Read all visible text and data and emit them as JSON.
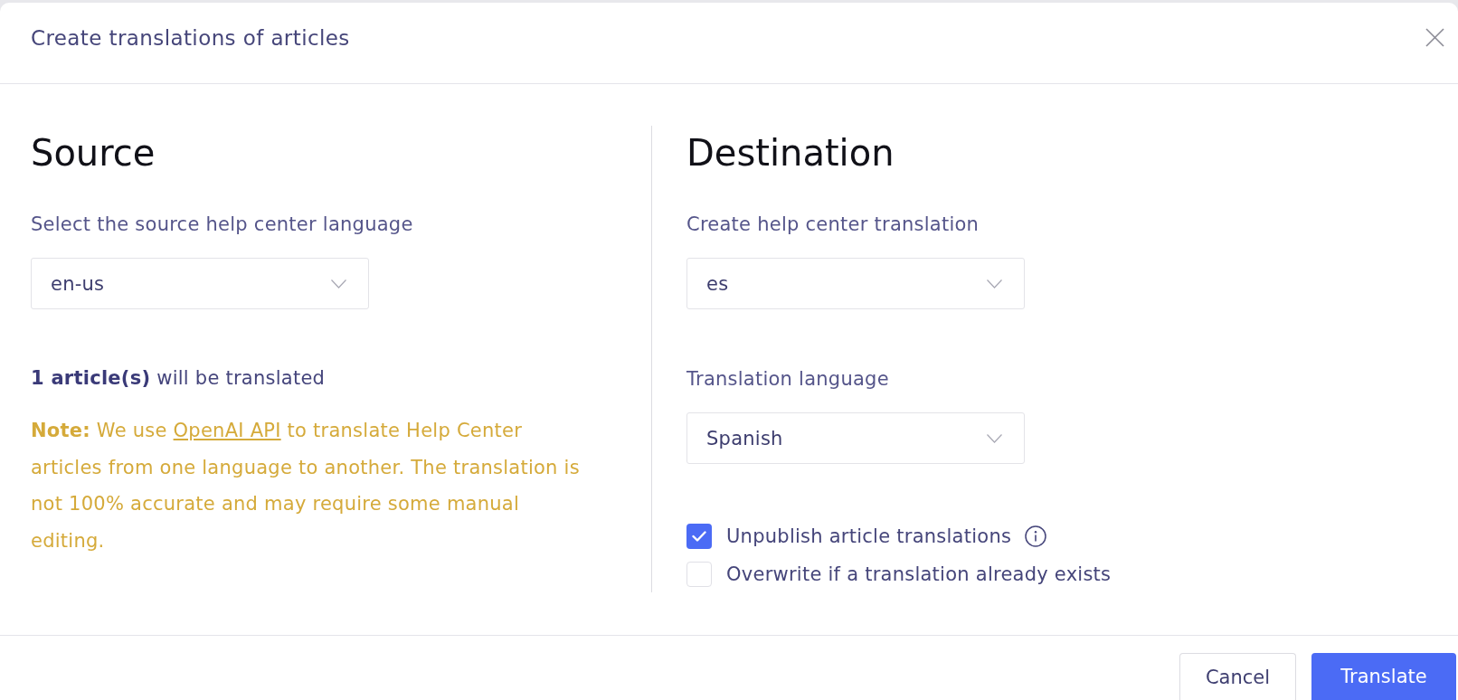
{
  "dialog": {
    "title": "Create translations of articles"
  },
  "source": {
    "heading": "Source",
    "field": {
      "label": "Select the source help center language",
      "value": "en-us"
    },
    "summary": "**1 article(s)** will be translated",
    "note": {
      "before": "**Note:** We use ",
      "link": "OpenAI API",
      "after": " to translate Help Center articles from one language to another. The translation is not 100% accurate and may require some manual editing."
    }
  },
  "destination": {
    "heading": "Destination",
    "fields": [
      {
        "label": "Create help center translation",
        "value": "es"
      },
      {
        "label": "Translation language",
        "value": "Spanish"
      }
    ],
    "options": [
      {
        "label": "Unpublish article translations",
        "checked": true,
        "info": true
      },
      {
        "label": "Overwrite if a translation already exists",
        "checked": false,
        "info": false
      }
    ]
  },
  "buttons": [
    {
      "label": "Cancel",
      "kind": "secondary"
    },
    {
      "label": "Translate",
      "kind": "primary"
    }
  ]
}
